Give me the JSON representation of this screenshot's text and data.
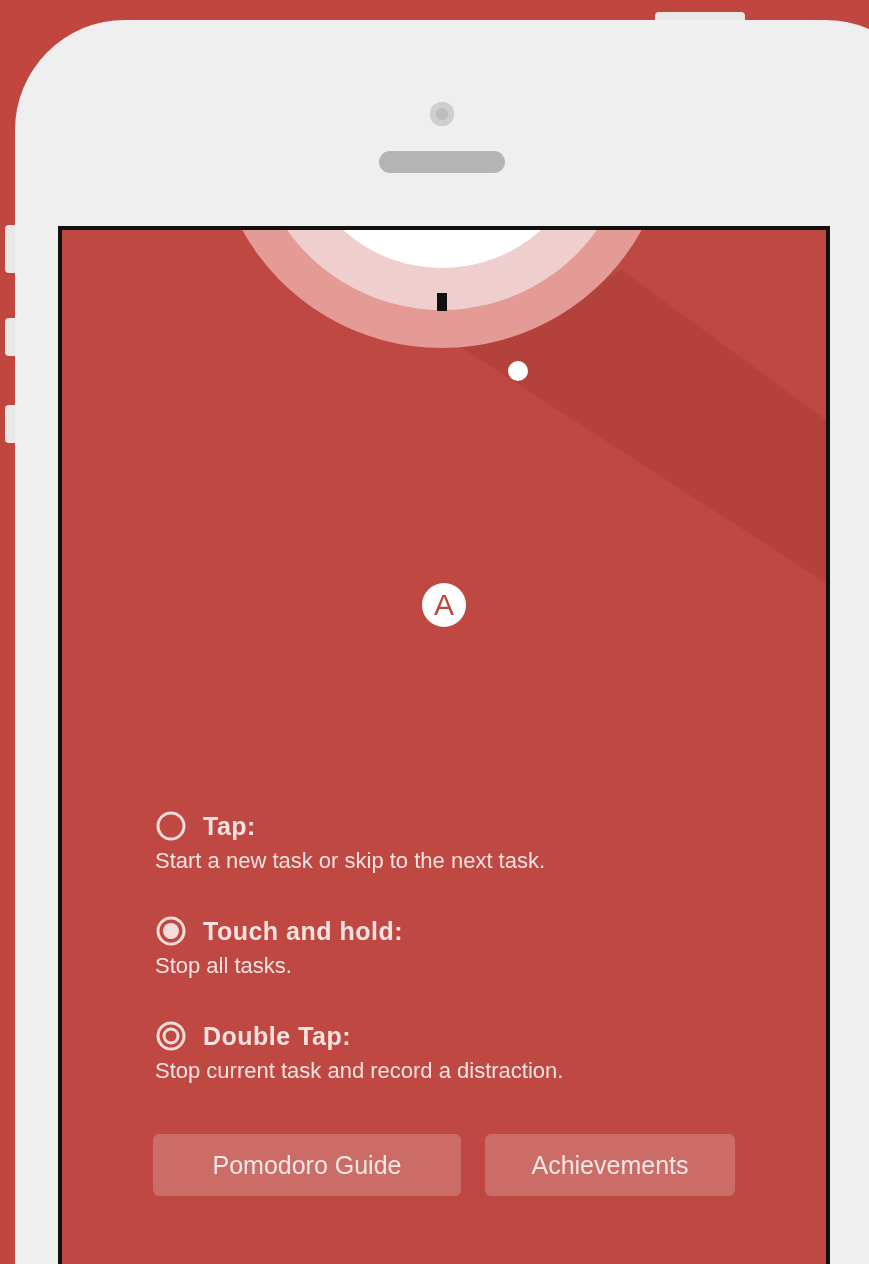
{
  "logo_letter": "A",
  "gestures": [
    {
      "kind": "tap",
      "title": "Tap:",
      "description": "Start a new task or skip to the next task."
    },
    {
      "kind": "hold",
      "title": "Touch and hold:",
      "description": "Stop all tasks."
    },
    {
      "kind": "double",
      "title": "Double Tap:",
      "description": "Stop current task and record a distraction."
    }
  ],
  "buttons": [
    "Pomodoro Guide",
    "Achievements"
  ]
}
